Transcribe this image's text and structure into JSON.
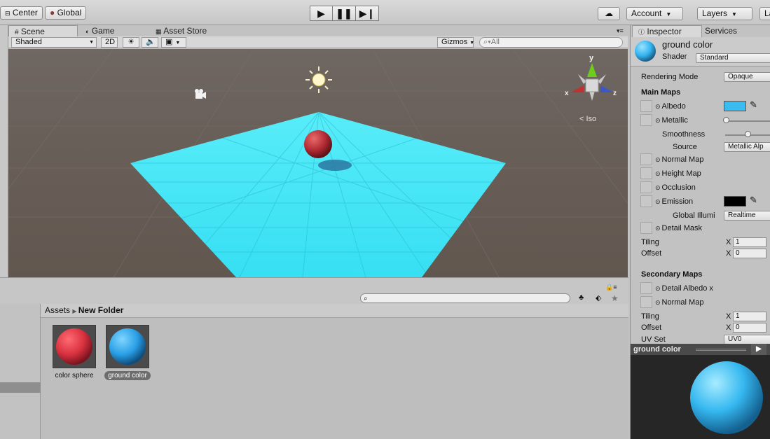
{
  "toolbar": {
    "center_label": "Center",
    "global_label": "Global",
    "account_label": "Account",
    "layers_label": "Layers",
    "layout_label": "La",
    "play_icon": "play-icon",
    "pause_icon": "pause-icon",
    "step_icon": "step-icon"
  },
  "scene_tabs": [
    {
      "label": "Scene"
    },
    {
      "label": "Game"
    },
    {
      "label": "Asset Store"
    }
  ],
  "scene_toolbar": {
    "shading": "Shaded",
    "mode_2d": "2D",
    "gizmos": "Gizmos",
    "search_placeholder": "All"
  },
  "gizmo": {
    "y": "y",
    "x": "x",
    "z": "z",
    "projection": "Iso"
  },
  "colors": {
    "ground": "#3fe6f5",
    "sphere": "#c0303a",
    "albedo": "#3bbcf0"
  },
  "project": {
    "breadcrumb_root": "Assets",
    "breadcrumb_folder": "New Folder",
    "assets": [
      {
        "name": "color sphere",
        "color": "#d9313f"
      },
      {
        "name": "ground color",
        "color": "#2a9fe6"
      }
    ]
  },
  "inspector": {
    "tab_inspector": "Inspector",
    "tab_services": "Services",
    "material_name": "ground color",
    "shader_label": "Shader",
    "shader_value": "Standard",
    "rendering_mode_label": "Rendering Mode",
    "rendering_mode_value": "Opaque",
    "main_maps": "Main Maps",
    "albedo": "Albedo",
    "metallic": "Metallic",
    "smoothness": "Smoothness",
    "source": "Source",
    "source_value": "Metallic Alp",
    "normal_map": "Normal Map",
    "height_map": "Height Map",
    "occlusion": "Occlusion",
    "emission": "Emission",
    "global_illum": "Global Illumi",
    "global_illum_value": "Realtime",
    "detail_mask": "Detail Mask",
    "tiling": "Tiling",
    "offset": "Offset",
    "x_label": "X",
    "tiling_x": "1",
    "offset_x": "0",
    "secondary_maps": "Secondary Maps",
    "detail_albedo": "Detail Albedo x",
    "normal_map_2": "Normal Map",
    "tiling_x2": "1",
    "offset_x2": "0",
    "uv_set": "UV Set",
    "uv_set_value": "UV0",
    "preview_title": "ground color"
  }
}
